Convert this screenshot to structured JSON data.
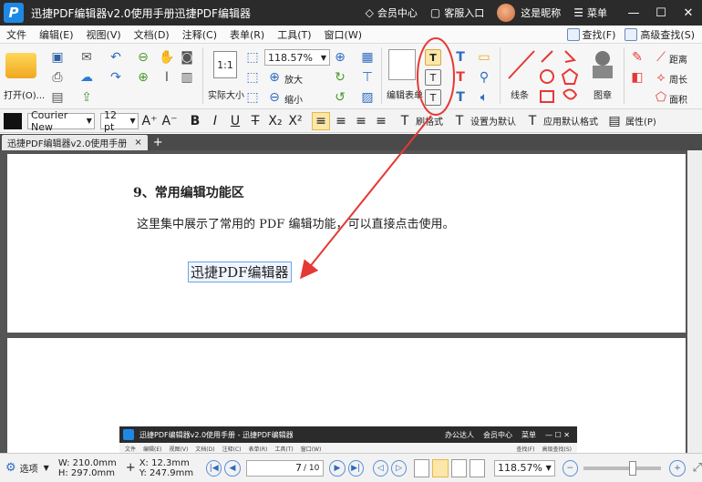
{
  "window": {
    "logo": "P",
    "title": "迅捷PDF编辑器v2.0使用手册迅捷PDF编辑器",
    "member_center": "会员中心",
    "support": "客服入口",
    "username": "这是昵称",
    "menu": "菜单"
  },
  "menubar": {
    "items": [
      "文件",
      "编辑(E)",
      "视图(V)",
      "文档(D)",
      "注释(C)",
      "表单(R)",
      "工具(T)",
      "窗口(W)"
    ],
    "find": "查找(F)",
    "advanced_find": "高级查找(S)"
  },
  "ribbon": {
    "open": "打开(O)...",
    "actual_size": "实际大小",
    "zoom_value": "118.57%",
    "zoom_in": "放大",
    "zoom_out": "缩小",
    "edit_form": "编辑表单",
    "line": "线条",
    "stamp": "图章",
    "distance": "距离",
    "perimeter": "周长",
    "area": "面积",
    "t_glyph": "T",
    "fit_glyph": "1:1"
  },
  "formatbar": {
    "font": "Courier New",
    "size": "12 pt",
    "bold": "B",
    "italic": "I",
    "underline": "U",
    "strike": "T",
    "subscript": "X₂",
    "superscript": "X²",
    "grow_font": "A⁺",
    "shrink_font": "A⁻",
    "format_painter": "刷格式",
    "set_default": "设置为默认",
    "apply_default": "应用默认格式",
    "properties": "属性(P)"
  },
  "tabs": {
    "active": "迅捷PDF编辑器v2.0使用手册",
    "close": "×",
    "add": "+"
  },
  "document": {
    "heading": "9、常用编辑功能区",
    "body": "这里集中展示了常用的 PDF 编辑功能，可以直接点击使用。",
    "edit_text": "迅捷PDF编辑器"
  },
  "inner_screenshot": {
    "title": "迅捷PDF编辑器v2.0使用手册 - 迅捷PDF编辑器",
    "office": "办公达人",
    "member": "会员中心",
    "menu": "菜单",
    "menu_items": [
      "文件",
      "编辑(E)",
      "视图(V)",
      "文档(D)",
      "注释(C)",
      "表单(R)",
      "工具(T)",
      "窗口(W)"
    ],
    "find": "查找(F)",
    "advanced_find": "高级查找(S)"
  },
  "statusbar": {
    "select": "选项",
    "width": "W: 210.0mm",
    "height": "H: 297.0mm",
    "x": "X:    12.3mm",
    "y": "Y:  247.9mm",
    "page": "7",
    "page_total": "/ 10",
    "zoom": "118.57%"
  },
  "colors": {
    "title_bg": "#2b2b2b",
    "annotation": "#e53935",
    "accent": "#1e88e5"
  }
}
